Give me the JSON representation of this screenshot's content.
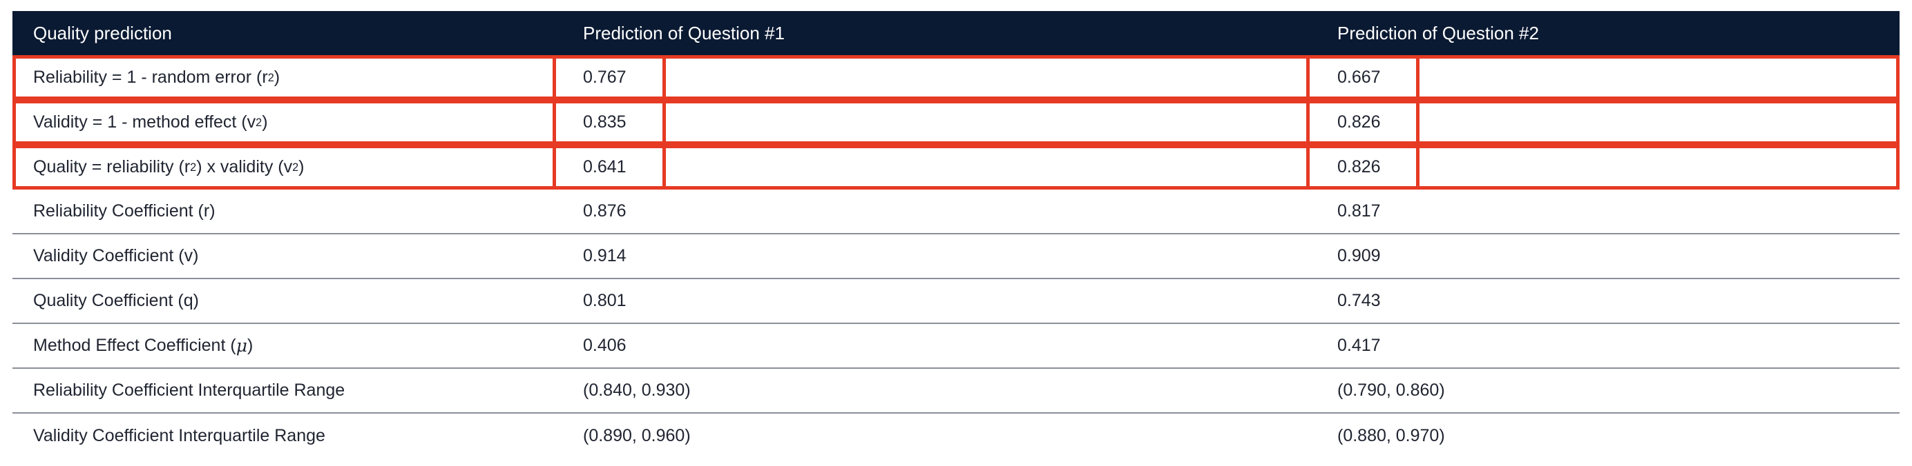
{
  "header": {
    "col1": "Quality prediction",
    "col2": "Prediction of Question #1",
    "col3": "Prediction of Question #2"
  },
  "rows": [
    {
      "label_pre": "Reliability = 1 - random error (r",
      "label_sup": "2",
      "label_post": ")",
      "q1": "0.767",
      "q2": "0.667"
    },
    {
      "label_pre": "Validity = 1 - method effect (v",
      "label_sup": "2",
      "label_post": ")",
      "q1": "0.835",
      "q2": "0.826"
    },
    {
      "label_pre": "Quality = reliability (r",
      "label_sup": "2",
      "label_mid": ") x validity (v",
      "label_sup2": "2",
      "label_post": ")",
      "q1": "0.641",
      "q2": "0.826"
    },
    {
      "label": "Reliability Coefficient (r)",
      "q1": "0.876",
      "q2": "0.817"
    },
    {
      "label": "Validity Coefficient (v)",
      "q1": "0.914",
      "q2": "0.909"
    },
    {
      "label": "Quality Coefficient (q)",
      "q1": "0.801",
      "q2": "0.743"
    },
    {
      "label_pre": "Method Effect Coefficient (",
      "label_symbol": "μ",
      "label_post": ")",
      "q1": "0.406",
      "q2": "0.417"
    },
    {
      "label": "Reliability Coefficient Interquartile Range",
      "q1": "(0.840, 0.930)",
      "q2": "(0.790, 0.860)"
    },
    {
      "label": "Validity Coefficient Interquartile Range",
      "q1": "(0.890, 0.960)",
      "q2": "(0.880, 0.970)"
    }
  ],
  "colors": {
    "header_bg": "#0b1a33",
    "highlight": "#e63a24"
  }
}
